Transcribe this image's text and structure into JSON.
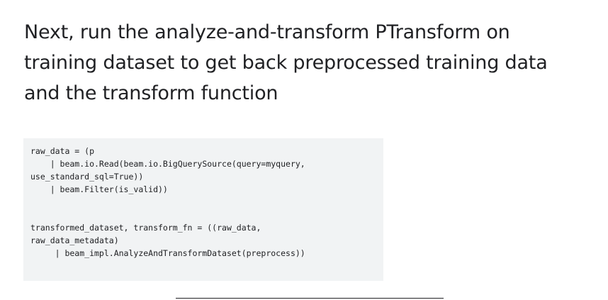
{
  "slide": {
    "heading_lines": [
      "Next, run the analyze-and-transform PTransform on",
      "training dataset to get back preprocessed training data",
      "and the transform function"
    ],
    "code_block_1": [
      "raw_data = (p",
      "    | beam.io.Read(beam.io.BigQuerySource(query=myquery,",
      "use_standard_sql=True))",
      "    | beam.Filter(is_valid))"
    ],
    "code_block_2": [
      "transformed_dataset, transform_fn = ((raw_data,",
      "raw_data_metadata)",
      "     | beam_impl.AnalyzeAndTransformDataset(preprocess))"
    ]
  }
}
